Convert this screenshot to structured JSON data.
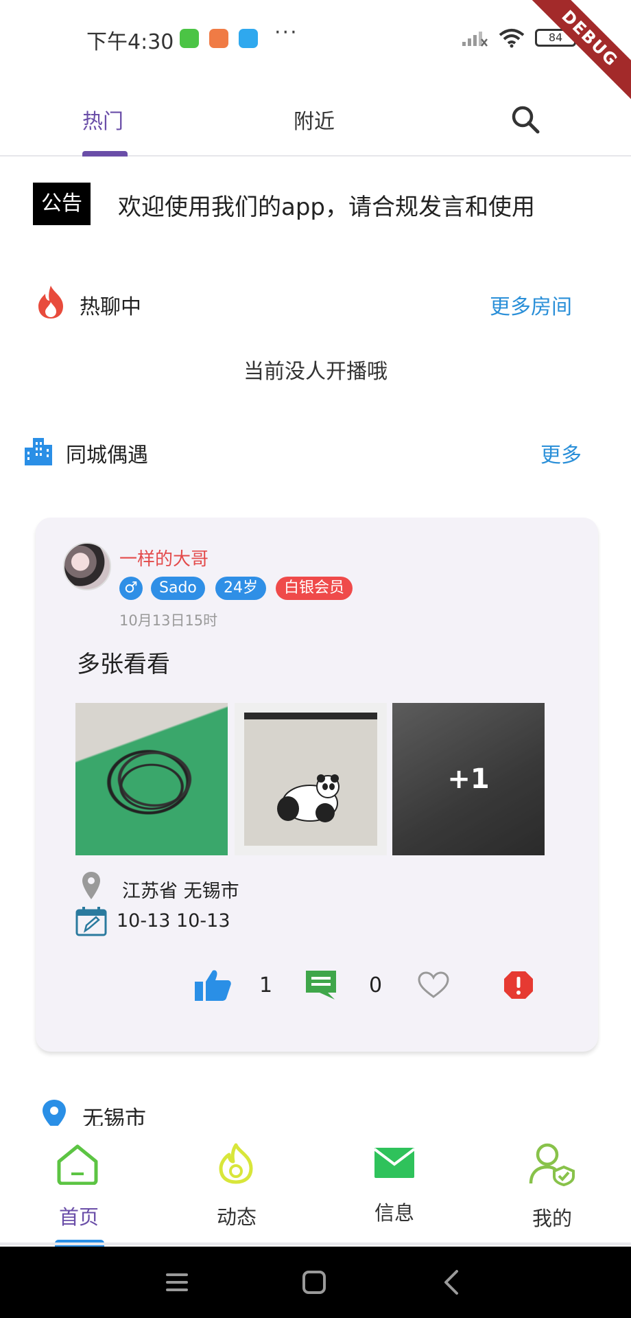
{
  "status_bar": {
    "time": "下午4:30",
    "dots": "···",
    "battery": "84"
  },
  "debug_banner": "DEBUG",
  "top_tabs": {
    "tabs": [
      {
        "label": "热门",
        "active": true
      },
      {
        "label": "附近",
        "active": false
      }
    ],
    "search_icon": "search-icon"
  },
  "announcement": {
    "badge": "公告",
    "text": "欢迎使用我们的app，请合规发言和使用"
  },
  "hot_chat": {
    "title": "热聊中",
    "more": "更多房间",
    "empty_tip": "当前没人开播哦"
  },
  "same_city": {
    "title": "同城偶遇",
    "more": "更多"
  },
  "post": {
    "user_name": "一样的大哥",
    "gender": "♂",
    "tags": [
      "Sado",
      "24岁",
      "白银会员"
    ],
    "time": "10月13日15时",
    "content": "多张看看",
    "more_photos": "+1",
    "location": "江苏省 无锡市",
    "dates": "10-13   10-13",
    "likes": "1",
    "comments": "0"
  },
  "city_section": {
    "label": "无锡市"
  },
  "bottom_nav": {
    "items": [
      {
        "label": "首页",
        "icon": "home-icon",
        "active": true
      },
      {
        "label": "动态",
        "icon": "flame-icon",
        "active": false
      },
      {
        "label": "信息",
        "icon": "mail-icon",
        "active": false
      },
      {
        "label": "我的",
        "icon": "profile-icon",
        "active": false
      }
    ]
  },
  "colors": {
    "accent_purple": "#6a4ea8",
    "link_blue": "#2a8fd8",
    "name_red": "#e34a4a",
    "card_bg": "#f4f2f8"
  }
}
